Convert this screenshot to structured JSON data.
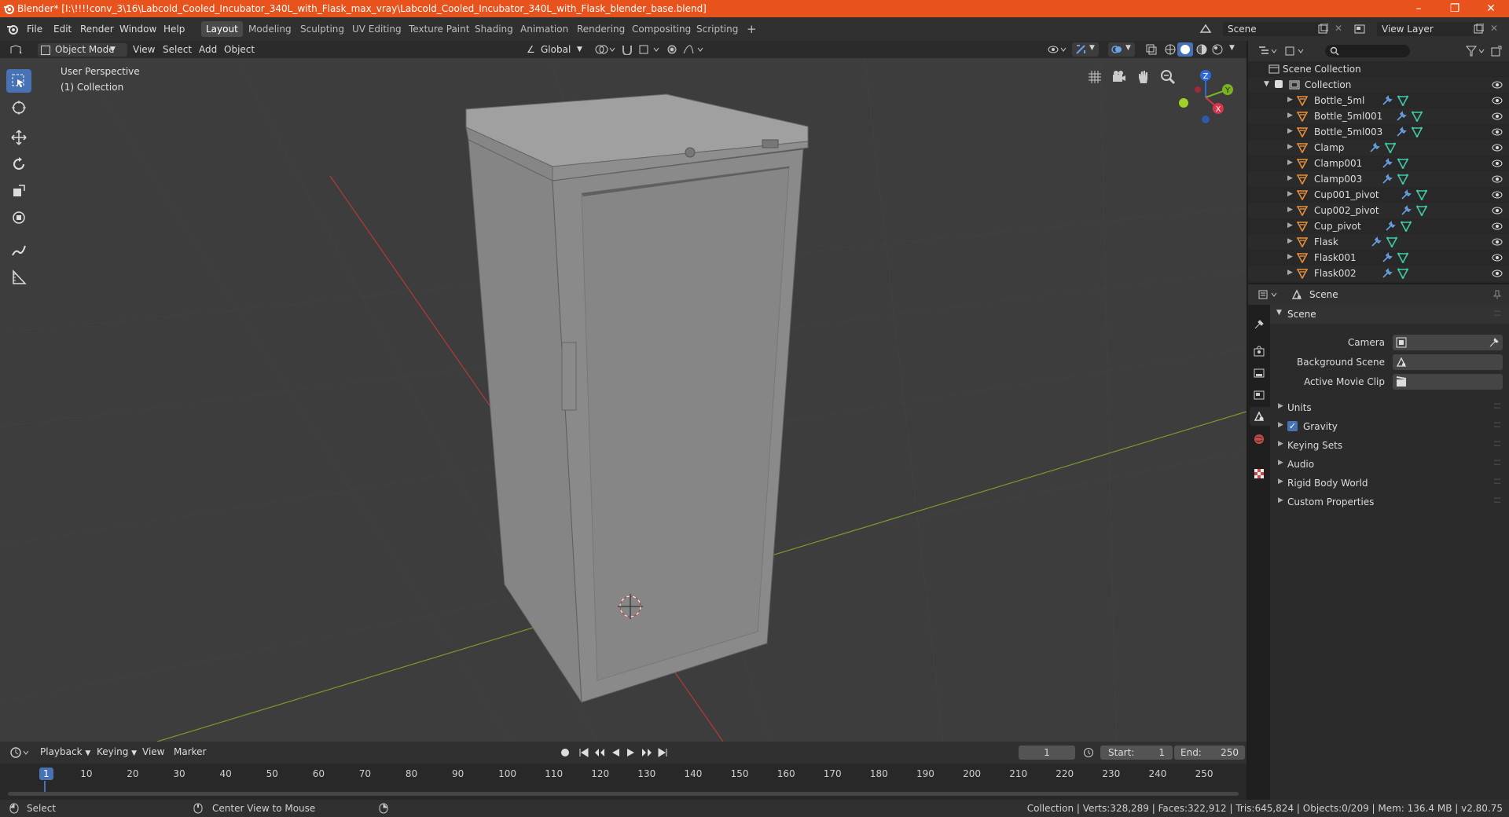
{
  "window": {
    "title": "Blender* [I:\\!!!!conv_3\\16\\Labcold_Cooled_Incubator_340L_with_Flask_max_vray\\Labcold_Cooled_Incubator_340L_with_Flask_blender_base.blend]",
    "controls": [
      "minimize",
      "maximize",
      "close"
    ]
  },
  "menubar": {
    "menus": [
      "File",
      "Edit",
      "Render",
      "Window",
      "Help"
    ],
    "workspaces": [
      "Layout",
      "Modeling",
      "Sculpting",
      "UV Editing",
      "Texture Paint",
      "Shading",
      "Animation",
      "Rendering",
      "Compositing",
      "Scripting"
    ],
    "active_workspace": "Layout",
    "scene_field": "Scene",
    "view_layer_field": "View Layer"
  },
  "viewport_header": {
    "mode": "Object Mode",
    "menus": [
      "View",
      "Select",
      "Add",
      "Object"
    ],
    "transform_orientation": "Global"
  },
  "viewport": {
    "perspective_label": "User Perspective",
    "collection_label": "(1) Collection",
    "gizmo_axes": [
      "X",
      "Y",
      "Z"
    ]
  },
  "outliner": {
    "root": "Scene Collection",
    "collection": "Collection",
    "items": [
      "Bottle_5ml",
      "Bottle_5ml001",
      "Bottle_5ml003",
      "Clamp",
      "Clamp001",
      "Clamp003",
      "Cup001_pivot",
      "Cup002_pivot",
      "Cup_pivot",
      "Flask",
      "Flask001",
      "Flask002"
    ]
  },
  "properties": {
    "header_title": "Scene",
    "panel_title": "Scene",
    "fields": [
      {
        "label": "Camera",
        "value": ""
      },
      {
        "label": "Background Scene",
        "value": ""
      },
      {
        "label": "Active Movie Clip",
        "value": ""
      }
    ],
    "sections": [
      {
        "label": "Units",
        "checkbox": false
      },
      {
        "label": "Gravity",
        "checkbox": true,
        "checked": true
      },
      {
        "label": "Keying Sets",
        "checkbox": false
      },
      {
        "label": "Audio",
        "checkbox": false
      },
      {
        "label": "Rigid Body World",
        "checkbox": false
      },
      {
        "label": "Custom Properties",
        "checkbox": false
      }
    ]
  },
  "timeline": {
    "menus": [
      "Playback",
      "Keying",
      "View",
      "Marker"
    ],
    "current_frame": "1",
    "start_label": "Start:",
    "start": "1",
    "end_label": "End:",
    "end": "250",
    "ticks": [
      "1",
      "10",
      "20",
      "30",
      "40",
      "50",
      "60",
      "70",
      "80",
      "90",
      "100",
      "110",
      "120",
      "130",
      "140",
      "150",
      "160",
      "170",
      "180",
      "190",
      "200",
      "210",
      "220",
      "230",
      "240",
      "250"
    ]
  },
  "statusbar": {
    "left_action": "Select",
    "middle_action": "Center View to Mouse",
    "stats": "Collection | Verts:328,289 | Faces:322,912 | Tris:645,824 | Objects:0/209 | Mem: 136.4 MB | v2.80.75"
  },
  "colors": {
    "titlebar": "#e8521c",
    "accent": "#4772b3",
    "object_icon": "#e8903a",
    "mesh_icon": "#3fc9a4",
    "modifier_icon": "#6ba0e6"
  }
}
